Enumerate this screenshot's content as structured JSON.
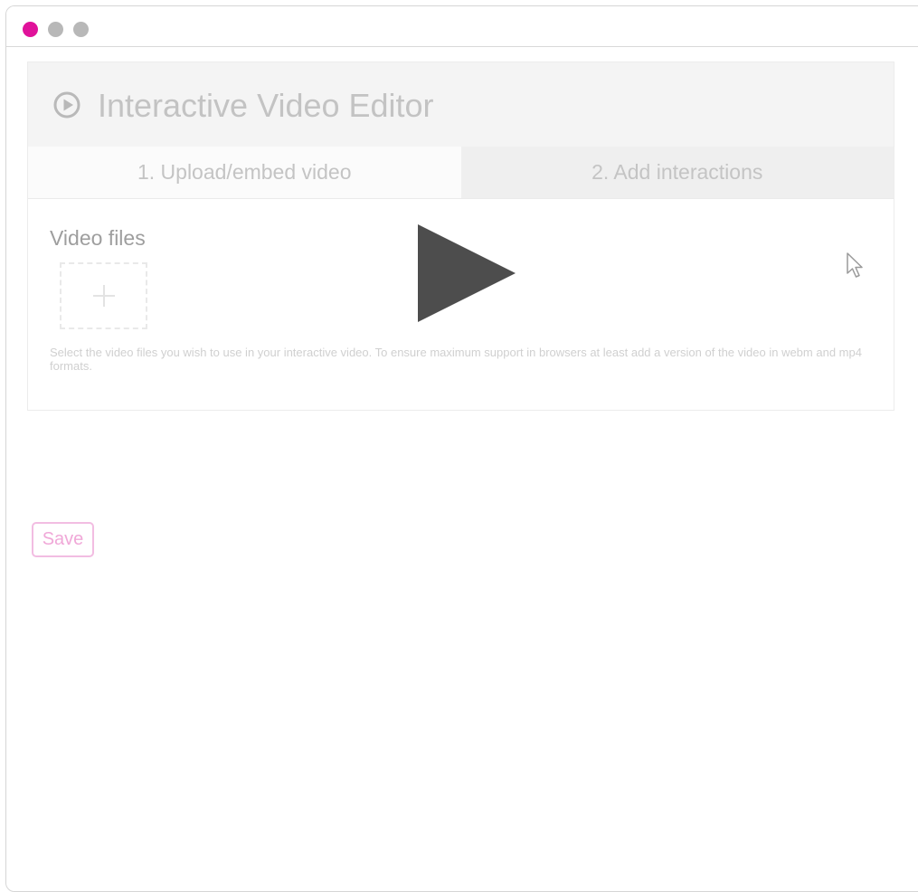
{
  "window": {
    "controls": [
      {
        "name": "close",
        "color": "#e0129a"
      },
      {
        "name": "minimize",
        "color": "#b8b8b8"
      },
      {
        "name": "maximize",
        "color": "#b8b8b8"
      }
    ]
  },
  "editor": {
    "icon": "play-circle-icon",
    "title": "Interactive Video Editor",
    "tabs": [
      {
        "label": "1. Upload/embed video",
        "active": true
      },
      {
        "label": "2. Add interactions",
        "active": false
      }
    ],
    "section_label": "Video files",
    "add_icon": "plus-icon",
    "help_text": "Select the video files you wish to use in your interactive video. To ensure maximum support in browsers at least add a version of the video in webm and mp4 formats."
  },
  "overlay": {
    "play_icon": "play-icon",
    "cursor_icon": "mouse-pointer-icon"
  },
  "save_label": "Save",
  "colors": {
    "accent": "#e0129a",
    "save_border": "#f2bde2",
    "play_fill": "#4d4d4d"
  }
}
